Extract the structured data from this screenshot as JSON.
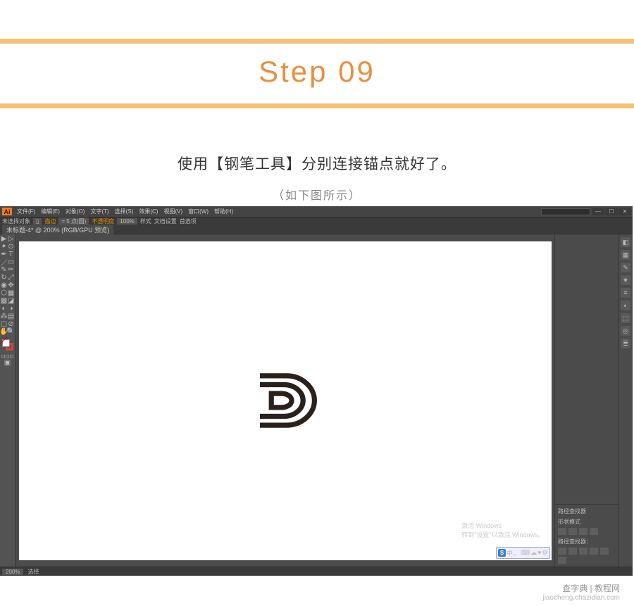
{
  "header": {
    "title": "Step 09"
  },
  "instruction": {
    "main": "使用【钢笔工具】分别连接锚点就好了。",
    "sub": "（如下图所示）"
  },
  "ai": {
    "menu": {
      "file": "文件(F)",
      "edit": "编辑(E)",
      "object": "对象(O)",
      "type": "文字(T)",
      "select": "选择(S)",
      "effect": "效果(C)",
      "view": "视图(V)",
      "window": "窗口(W)",
      "help": "帮助(H)"
    },
    "controlbar": {
      "noselect": "未选择对象",
      "stroke": "描边",
      "strokeval": "= 5 点(圆)",
      "opacity_label": "不透明度",
      "opacity": "100%",
      "style": "样式",
      "docsetup": "文档设置",
      "prefs": "首选项"
    },
    "tab": "未标题-4* @ 200% (RGB/GPU 预览)",
    "panels": {
      "pathfinder_title": "路径查找器",
      "shapemode_label": "形状模式",
      "pathfinder_label": "路径查找器："
    },
    "status": {
      "zoom": "200%",
      "tool": "选择"
    },
    "watermark_win": "激活 Windows",
    "watermark_win_sub": "转到\"设置\"以激活 Windows。",
    "ime": "中"
  },
  "watermark": {
    "line1": "查字典 | 教程网",
    "line2": "jiaocheng.chazidian.com"
  }
}
